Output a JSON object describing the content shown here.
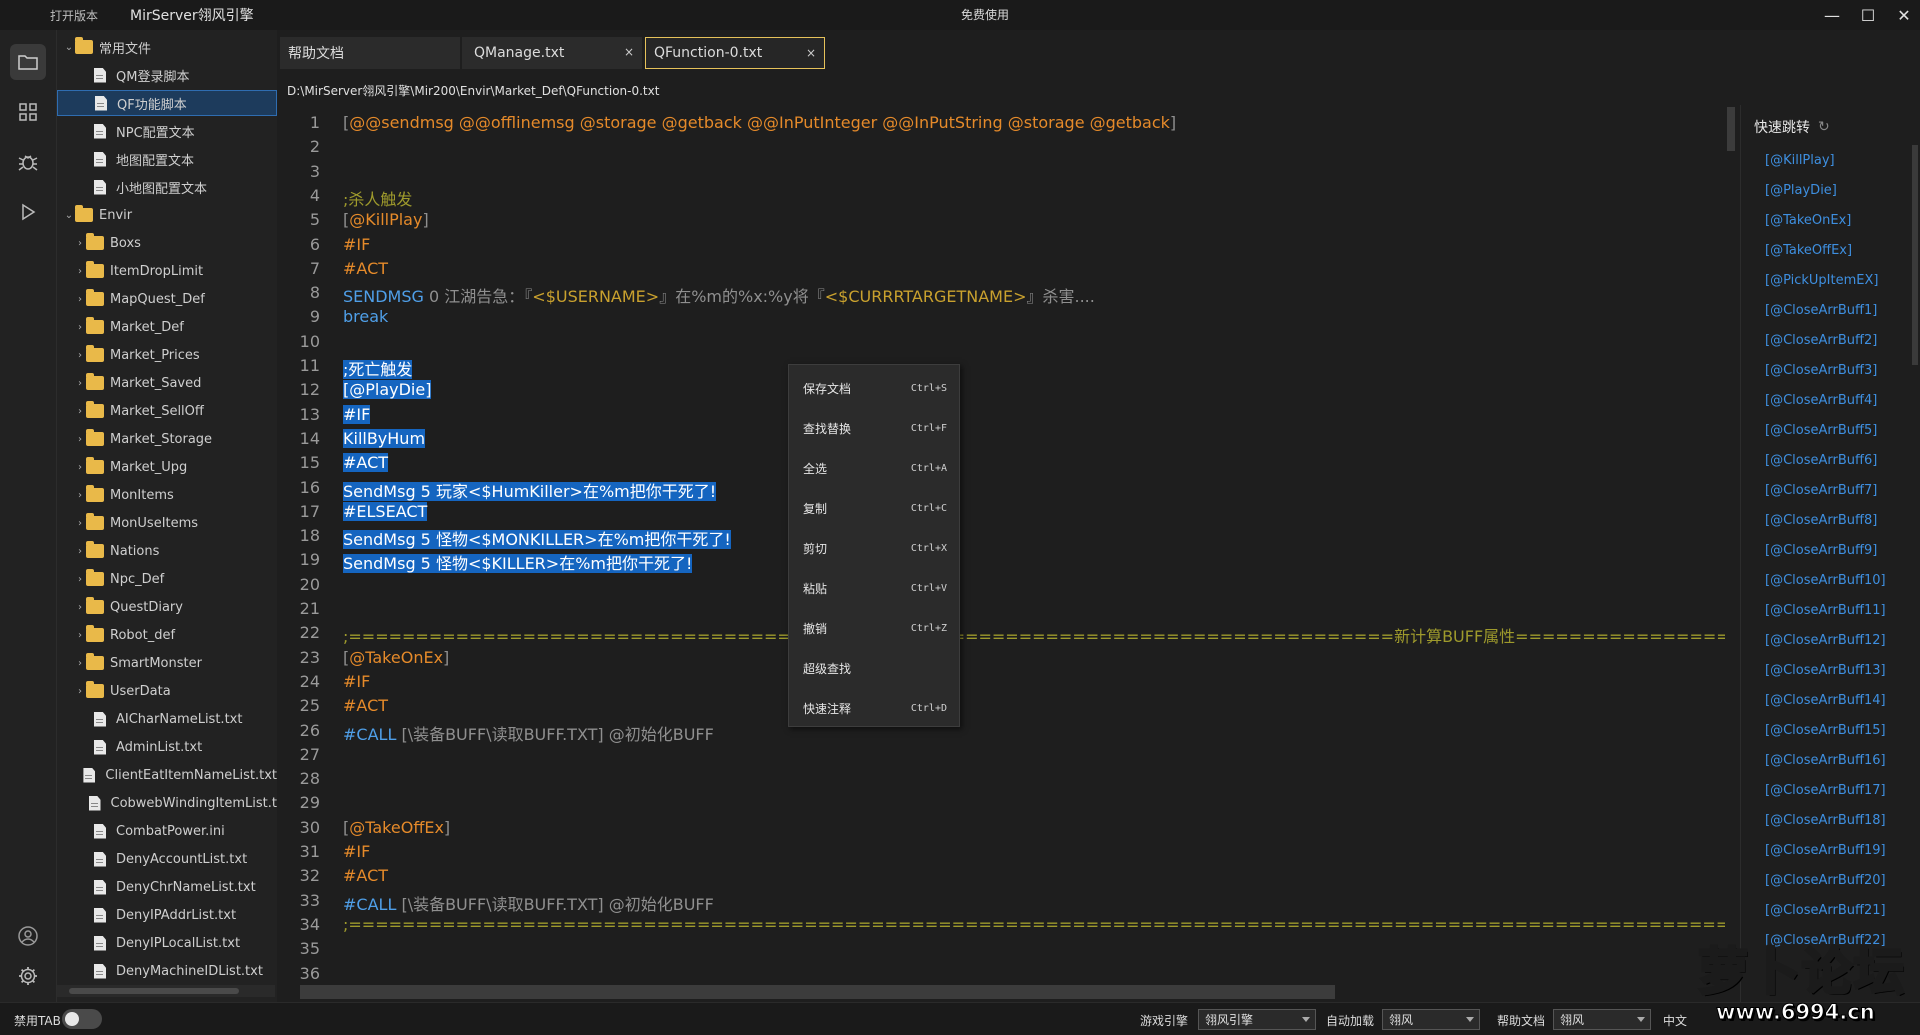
{
  "titlebar": {
    "open_version": "打开版本",
    "app_name": "MirServer翎风引擎",
    "center_text": "免费使用",
    "minimize": "—",
    "maximize": "☐",
    "close": "✕"
  },
  "sidebar": {
    "items": [
      {
        "label": "常用文件",
        "type": "folder",
        "expanded": true,
        "indent": 0
      },
      {
        "label": "QM登录脚本",
        "type": "file",
        "indent": 1
      },
      {
        "label": "QF功能脚本",
        "type": "file",
        "indent": 1,
        "selected": true
      },
      {
        "label": "NPC配置文本",
        "type": "file",
        "indent": 1
      },
      {
        "label": "地图配置文本",
        "type": "file",
        "indent": 1
      },
      {
        "label": "小地图配置文本",
        "type": "file",
        "indent": 1
      },
      {
        "label": "Envir",
        "type": "folder",
        "expanded": true,
        "indent": 0
      },
      {
        "label": "Boxs",
        "type": "folder",
        "indent": 1
      },
      {
        "label": "ItemDropLimit",
        "type": "folder",
        "indent": 1
      },
      {
        "label": "MapQuest_Def",
        "type": "folder",
        "indent": 1
      },
      {
        "label": "Market_Def",
        "type": "folder",
        "indent": 1
      },
      {
        "label": "Market_Prices",
        "type": "folder",
        "indent": 1
      },
      {
        "label": "Market_Saved",
        "type": "folder",
        "indent": 1
      },
      {
        "label": "Market_SellOff",
        "type": "folder",
        "indent": 1
      },
      {
        "label": "Market_Storage",
        "type": "folder",
        "indent": 1
      },
      {
        "label": "Market_Upg",
        "type": "folder",
        "indent": 1
      },
      {
        "label": "MonItems",
        "type": "folder",
        "indent": 1
      },
      {
        "label": "MonUseItems",
        "type": "folder",
        "indent": 1
      },
      {
        "label": "Nations",
        "type": "folder",
        "indent": 1
      },
      {
        "label": "Npc_Def",
        "type": "folder",
        "indent": 1
      },
      {
        "label": "QuestDiary",
        "type": "folder",
        "indent": 1
      },
      {
        "label": "Robot_def",
        "type": "folder",
        "indent": 1
      },
      {
        "label": "SmartMonster",
        "type": "folder",
        "indent": 1
      },
      {
        "label": "UserData",
        "type": "folder",
        "indent": 1
      },
      {
        "label": "AICharNameList.txt",
        "type": "file",
        "indent": 1
      },
      {
        "label": "AdminList.txt",
        "type": "file",
        "indent": 1
      },
      {
        "label": "ClientEatItemNameList.txt",
        "type": "file",
        "indent": 1
      },
      {
        "label": "CobwebWindingItemList.t",
        "type": "file",
        "indent": 1
      },
      {
        "label": "CombatPower.ini",
        "type": "file",
        "indent": 1
      },
      {
        "label": "DenyAccountList.txt",
        "type": "file",
        "indent": 1
      },
      {
        "label": "DenyChrNameList.txt",
        "type": "file",
        "indent": 1
      },
      {
        "label": "DenyIPAddrList.txt",
        "type": "file",
        "indent": 1
      },
      {
        "label": "DenyIPLocalList.txt",
        "type": "file",
        "indent": 1
      },
      {
        "label": "DenyMachineIDList.txt",
        "type": "file",
        "indent": 1
      }
    ]
  },
  "tabs": [
    {
      "label": "帮助文档",
      "closable": false,
      "active": false
    },
    {
      "label": "QManage.txt",
      "closable": true,
      "active": false
    },
    {
      "label": "QFunction-0.txt",
      "closable": true,
      "active": true
    }
  ],
  "tab_close_glyph": "×",
  "file_path": "D:\\MirServer翎风引擎\\Mir200\\Envir\\Market_Def\\QFunction-0.txt",
  "editor": {
    "lines": [
      {
        "n": "1",
        "segs": [
          {
            "t": "[",
            "c": "c-gray"
          },
          {
            "t": "@@sendmsg @@offlinemsg @storage @getback @@InPutInteger @@InPutString @storage @getback",
            "c": "c-lbl"
          },
          {
            "t": "]",
            "c": "c-gray"
          }
        ]
      },
      {
        "n": "2",
        "segs": []
      },
      {
        "n": "3",
        "segs": []
      },
      {
        "n": "4",
        "segs": [
          {
            "t": ";杀人触发",
            "c": "c-olive"
          }
        ]
      },
      {
        "n": "5",
        "segs": [
          {
            "t": "[",
            "c": "c-gray"
          },
          {
            "t": "@KillPlay",
            "c": "c-lbl"
          },
          {
            "t": "]",
            "c": "c-gray"
          }
        ]
      },
      {
        "n": "6",
        "segs": [
          {
            "t": "#IF",
            "c": "c-kw"
          }
        ]
      },
      {
        "n": "7",
        "segs": [
          {
            "t": "#ACT",
            "c": "c-kw"
          }
        ]
      },
      {
        "n": "8",
        "segs": [
          {
            "t": "SENDMSG",
            "c": "c-blue"
          },
          {
            "t": " 0 江湖告急：『",
            "c": "c-gray"
          },
          {
            "t": "<$USERNAME>",
            "c": "c-yel"
          },
          {
            "t": "』在%m的%x:%y将『",
            "c": "c-gray"
          },
          {
            "t": "<$CURRRTARGETNAME>",
            "c": "c-yel"
          },
          {
            "t": "』杀害....",
            "c": "c-gray"
          }
        ]
      },
      {
        "n": "9",
        "segs": [
          {
            "t": "break",
            "c": "c-blue"
          }
        ]
      },
      {
        "n": "10",
        "segs": []
      },
      {
        "n": "11",
        "segs": [
          {
            "t": ";死亡触发",
            "c": "sel"
          }
        ]
      },
      {
        "n": "12",
        "segs": [
          {
            "t": "[@PlayDie]",
            "c": "sel"
          }
        ]
      },
      {
        "n": "13",
        "segs": [
          {
            "t": "#IF",
            "c": "sel"
          }
        ]
      },
      {
        "n": "14",
        "segs": [
          {
            "t": "KillByHum ",
            "c": "sel"
          }
        ]
      },
      {
        "n": "15",
        "segs": [
          {
            "t": "#ACT",
            "c": "sel"
          }
        ]
      },
      {
        "n": "16",
        "segs": [
          {
            "t": "SendMsg 5 玩家<$HumKiller>在%m把你干死了!",
            "c": "sel"
          }
        ]
      },
      {
        "n": "17",
        "segs": [
          {
            "t": "#ELSEACT",
            "c": "sel"
          }
        ]
      },
      {
        "n": "18",
        "segs": [
          {
            "t": "SendMsg 5 怪物<$MONKILLER>在%m把你干死了!",
            "c": "sel"
          }
        ]
      },
      {
        "n": "19",
        "segs": [
          {
            "t": "SendMsg 5 怪物<$KILLER>在%m把你干死了!",
            "c": "sel"
          }
        ]
      },
      {
        "n": "20",
        "segs": []
      },
      {
        "n": "21",
        "segs": []
      },
      {
        "n": "22",
        "segs": [
          {
            "t": ";==============================================================================新计算BUFF属性====================================================",
            "c": "c-olive"
          }
        ]
      },
      {
        "n": "23",
        "segs": [
          {
            "t": "[",
            "c": "c-gray"
          },
          {
            "t": "@TakeOnEx",
            "c": "c-lbl"
          },
          {
            "t": "]",
            "c": "c-gray"
          }
        ]
      },
      {
        "n": "24",
        "segs": [
          {
            "t": "#IF",
            "c": "c-kw"
          }
        ]
      },
      {
        "n": "25",
        "segs": [
          {
            "t": "#ACT",
            "c": "c-kw"
          }
        ]
      },
      {
        "n": "26",
        "segs": [
          {
            "t": "#CALL",
            "c": "c-blue"
          },
          {
            "t": " [\\装备BUFF\\读取BUFF.TXT] @初始化BUFF",
            "c": "c-gray"
          }
        ]
      },
      {
        "n": "27",
        "segs": []
      },
      {
        "n": "28",
        "segs": []
      },
      {
        "n": "29",
        "segs": []
      },
      {
        "n": "30",
        "segs": [
          {
            "t": "[",
            "c": "c-gray"
          },
          {
            "t": "@TakeOffEx",
            "c": "c-lbl"
          },
          {
            "t": "]",
            "c": "c-gray"
          }
        ]
      },
      {
        "n": "31",
        "segs": [
          {
            "t": "#IF",
            "c": "c-kw"
          }
        ]
      },
      {
        "n": "32",
        "segs": [
          {
            "t": "#ACT",
            "c": "c-kw"
          }
        ]
      },
      {
        "n": "33",
        "segs": [
          {
            "t": "#CALL",
            "c": "c-blue"
          },
          {
            "t": " [\\装备BUFF\\读取BUFF.TXT] @初始化BUFF",
            "c": "c-gray"
          }
        ]
      },
      {
        "n": "34",
        "segs": [
          {
            "t": ";===============================================================================================================================",
            "c": "c-olive"
          }
        ]
      },
      {
        "n": "35",
        "segs": []
      },
      {
        "n": "36",
        "segs": []
      }
    ]
  },
  "context_menu": {
    "items": [
      {
        "label": "保存文档",
        "shortcut": "Ctrl+S"
      },
      {
        "label": "查找替换",
        "shortcut": "Ctrl+F"
      },
      {
        "label": "全选",
        "shortcut": "Ctrl+A"
      },
      {
        "label": "复制",
        "shortcut": "Ctrl+C"
      },
      {
        "label": "剪切",
        "shortcut": "Ctrl+X"
      },
      {
        "label": "粘贴",
        "shortcut": "Ctrl+V"
      },
      {
        "label": "撤销",
        "shortcut": "Ctrl+Z"
      },
      {
        "label": "超级查找",
        "shortcut": ""
      },
      {
        "label": "快速注释",
        "shortcut": "Ctrl+D"
      }
    ]
  },
  "quick_jump": {
    "title": "快速跳转",
    "items": [
      "[@KillPlay]",
      "[@PlayDie]",
      "[@TakeOnEx]",
      "[@TakeOffEx]",
      "[@PickUpItemEX]",
      "[@CloseArrBuff1]",
      "[@CloseArrBuff2]",
      "[@CloseArrBuff3]",
      "[@CloseArrBuff4]",
      "[@CloseArrBuff5]",
      "[@CloseArrBuff6]",
      "[@CloseArrBuff7]",
      "[@CloseArrBuff8]",
      "[@CloseArrBuff9]",
      "[@CloseArrBuff10]",
      "[@CloseArrBuff11]",
      "[@CloseArrBuff12]",
      "[@CloseArrBuff13]",
      "[@CloseArrBuff14]",
      "[@CloseArrBuff15]",
      "[@CloseArrBuff16]",
      "[@CloseArrBuff17]",
      "[@CloseArrBuff18]",
      "[@CloseArrBuff19]",
      "[@CloseArrBuff20]",
      "[@CloseArrBuff21]",
      "[@CloseArrBuff22]"
    ]
  },
  "statusbar": {
    "disable_tab_label": "禁用TAB",
    "game_engine_label": "游戏引擎",
    "game_engine_value": "翎风引擎",
    "auto_load_label": "自动加载",
    "auto_load_value": "翎风",
    "help_doc_label": "帮助文档",
    "help_doc_value": "翎风",
    "language": "中文"
  },
  "watermark": {
    "text": "萝卜论坛",
    "url": "www.6994.cn"
  },
  "colors": {
    "accent": "#1565c0",
    "tab_active_border": "#e6c25a",
    "label": "#e58a2a",
    "keyword_blue": "#4f9fe8",
    "link_blue": "#3e8fe0"
  }
}
